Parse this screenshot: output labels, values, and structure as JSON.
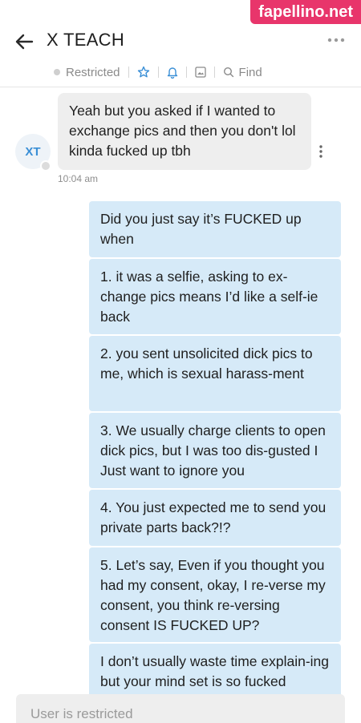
{
  "watermark": "fapellino.net",
  "header": {
    "title": "X TEACH"
  },
  "toolbar": {
    "restricted_label": "Restricted",
    "find_label": "Find"
  },
  "colors": {
    "accent": "#3a8fd6",
    "outgoing_bubble": "#d6eaf8",
    "incoming_bubble": "#eeeeee",
    "watermark_bg": "#e8356b"
  },
  "icons": [
    "back-arrow-icon",
    "more-options-icon",
    "star-icon",
    "bell-icon",
    "image-icon",
    "search-icon",
    "kebab-icon"
  ],
  "incoming": {
    "avatar_initials": "XT",
    "text": "Yeah but you asked if I wanted to exchange pics and then you don't lol kinda fucked up tbh",
    "time": "10:04 am"
  },
  "outgoing": [
    {
      "text": "Did you just say it’s FUCKED up when"
    },
    {
      "text": "1. it was a selfie, asking to ex-change pics means I’d like a self-ie back"
    },
    {
      "text": "2. you sent unsolicited dick pics to me, which is sexual harass-ment"
    },
    {
      "text": "3. We usually charge clients to open dick pics, but I was too dis-gusted I Just want to ignore you"
    },
    {
      "text": "4. You just expected me to send you private parts back?!?"
    },
    {
      "text": "5. Let’s say, Even if you thought you had my consent, okay, I re-verse my consent, you think re-versing consent IS FUCKED UP?"
    },
    {
      "text": "I don’t usually waste time explain-ing but your mind set is so fucked"
    }
  ],
  "composer": {
    "placeholder": "User is restricted"
  }
}
